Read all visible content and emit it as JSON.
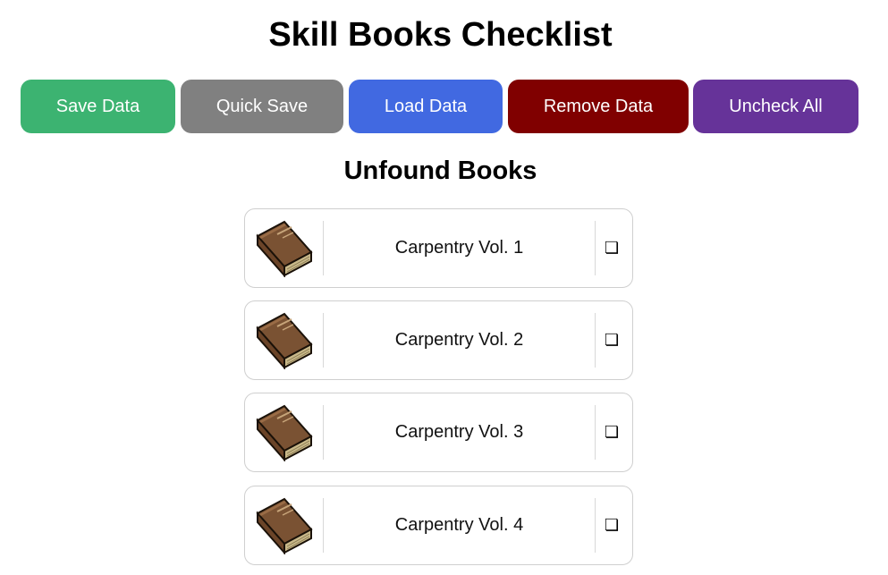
{
  "header": {
    "title": "Skill Books Checklist"
  },
  "toolbar": {
    "save_label": "Save Data",
    "quick_save_label": "Quick Save",
    "load_label": "Load Data",
    "remove_label": "Remove Data",
    "uncheck_label": "Uncheck All",
    "colors": {
      "save": "#3cb371",
      "quick_save": "#808080",
      "load": "#4169e1",
      "remove": "#800000",
      "uncheck": "#663399"
    }
  },
  "unfound": {
    "title": "Unfound Books",
    "books": [
      {
        "name": "Carpentry Vol. 1",
        "checked": false,
        "icon": "book-icon",
        "check_glyph": "❏"
      },
      {
        "name": "Carpentry Vol. 2",
        "checked": false,
        "icon": "book-icon",
        "check_glyph": "❏"
      },
      {
        "name": "Carpentry Vol. 3",
        "checked": false,
        "icon": "book-icon",
        "check_glyph": "❏"
      },
      {
        "name": "Carpentry Vol. 4",
        "checked": false,
        "icon": "book-icon",
        "check_glyph": "❏"
      }
    ]
  }
}
